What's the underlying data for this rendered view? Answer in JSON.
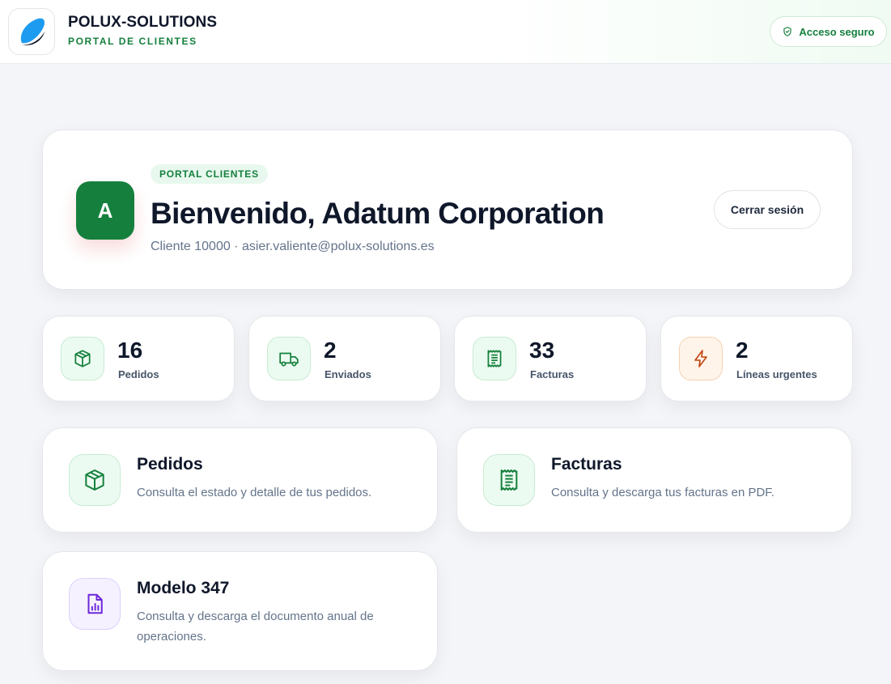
{
  "header": {
    "brand_name": "POLUX-SOLUTIONS",
    "brand_subtitle": "PORTAL DE CLIENTES",
    "secure_label": "Acceso seguro"
  },
  "welcome": {
    "pill": "PORTAL CLIENTES",
    "avatar_letter": "A",
    "title": "Bienvenido, Adatum Corporation",
    "subtitle": "Cliente 10000 · asier.valiente@polux-solutions.es",
    "logout_label": "Cerrar sesión"
  },
  "stats": [
    {
      "value": "16",
      "label": "Pedidos",
      "icon": "box-icon"
    },
    {
      "value": "2",
      "label": "Enviados",
      "icon": "truck-icon"
    },
    {
      "value": "33",
      "label": "Facturas",
      "icon": "receipt-icon"
    },
    {
      "value": "2",
      "label": "Líneas urgentes",
      "icon": "lightning-icon"
    }
  ],
  "features": [
    {
      "title": "Pedidos",
      "description": "Consulta el estado y detalle de tus pedidos.",
      "icon": "box-icon"
    },
    {
      "title": "Facturas",
      "description": "Consulta y descarga tus facturas en PDF.",
      "icon": "receipt-icon"
    },
    {
      "title": "Modelo 347",
      "description": "Consulta y descarga el documento anual de operaciones.",
      "icon": "report-document-icon"
    }
  ],
  "colors": {
    "brand_green": "#15803d",
    "urgent_orange": "#c2410c",
    "report_purple": "#6d28d9",
    "logo_blue": "#1d9bf0"
  }
}
